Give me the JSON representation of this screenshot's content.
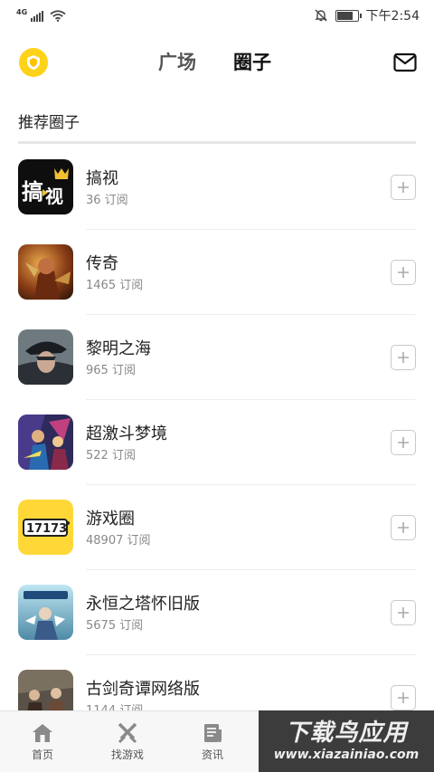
{
  "status_bar": {
    "network": "4G",
    "time": "下午2:54",
    "battery_level": 0.8
  },
  "header": {
    "tabs": [
      {
        "label": "广场",
        "active": false
      },
      {
        "label": "圈子",
        "active": true
      }
    ]
  },
  "section": {
    "title": "推荐圈子"
  },
  "circles": [
    {
      "name": "搞视",
      "subscribers": "36 订阅"
    },
    {
      "name": "传奇",
      "subscribers": "1465 订阅"
    },
    {
      "name": "黎明之海",
      "subscribers": "965 订阅"
    },
    {
      "name": "超激斗梦境",
      "subscribers": "522 订阅"
    },
    {
      "name": "游戏圈",
      "subscribers": "48907 订阅"
    },
    {
      "name": "永恒之塔怀旧版",
      "subscribers": "5675 订阅"
    },
    {
      "name": "古剑奇谭网络版",
      "subscribers": "1144 订阅"
    }
  ],
  "bottom_nav": [
    {
      "label": "首页",
      "icon": "home-icon"
    },
    {
      "label": "找游戏",
      "icon": "crossed-swords-icon"
    },
    {
      "label": "资讯",
      "icon": "news-icon"
    }
  ],
  "watermark": {
    "title": "下载鸟应用",
    "url": "www.xiazainiao.com"
  },
  "colors": {
    "accent": "#ffd21a",
    "text_primary": "#222222",
    "text_secondary": "#888888",
    "nav_background": "#f7f7f7"
  }
}
